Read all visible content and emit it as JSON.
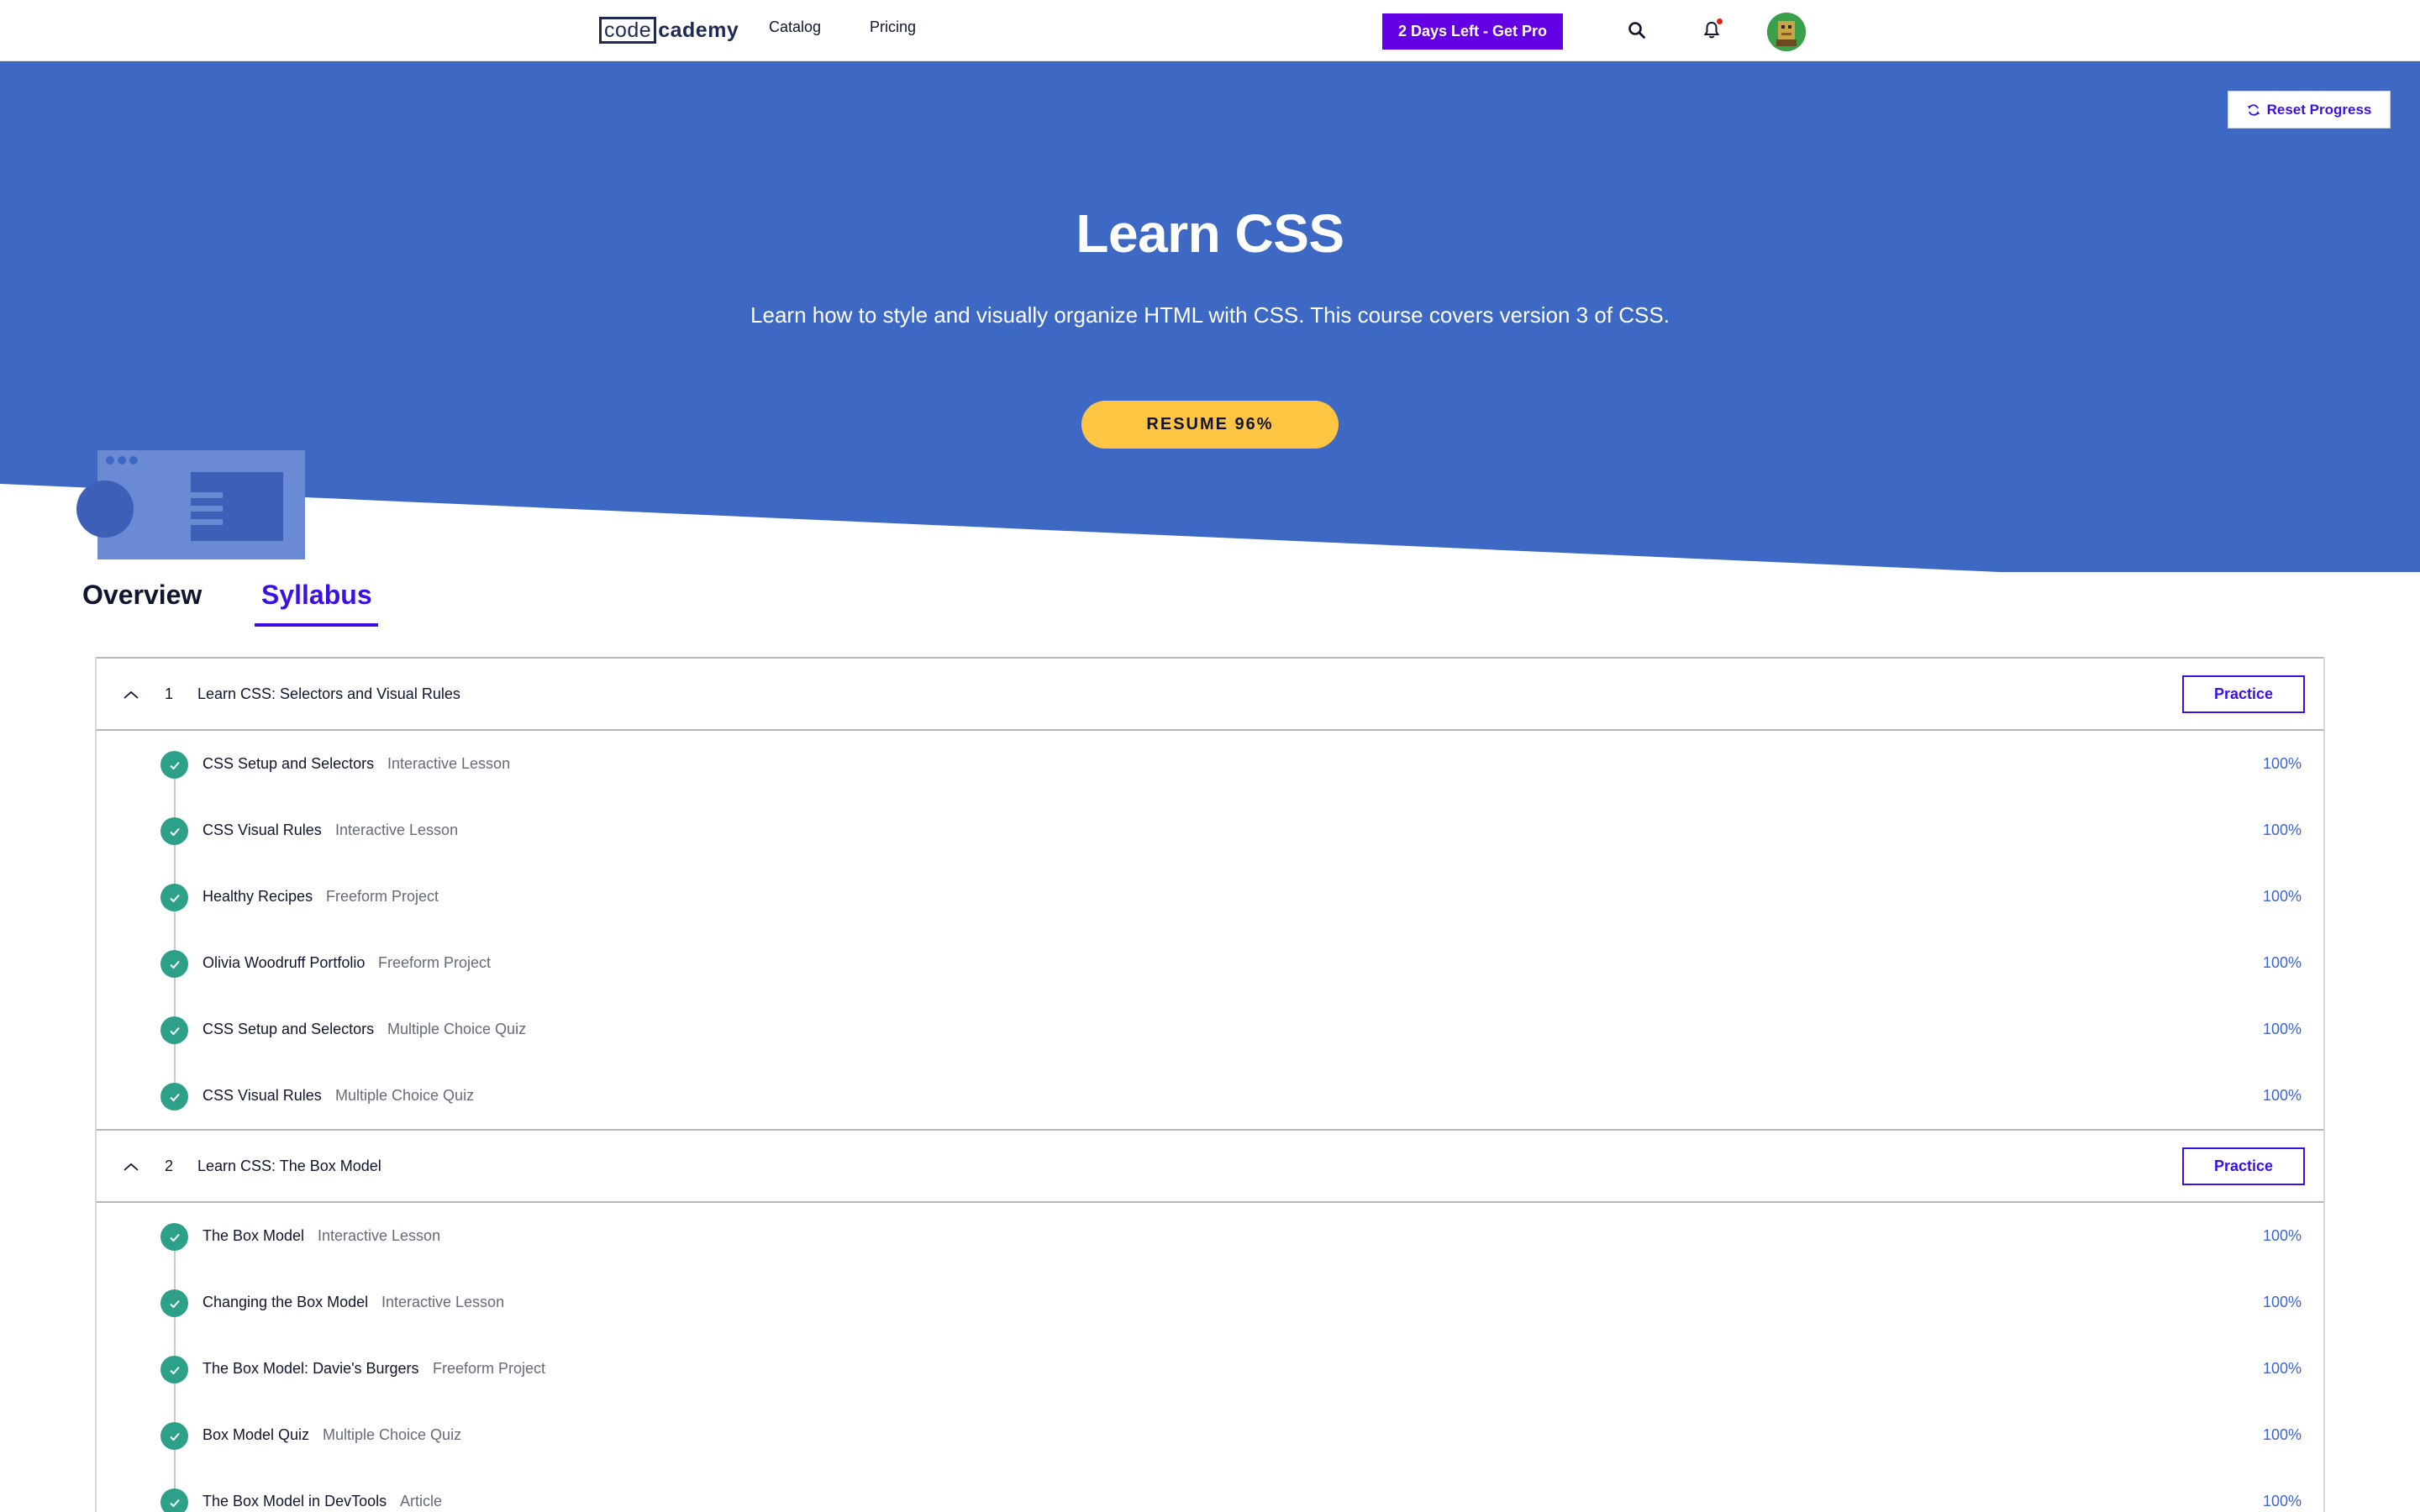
{
  "nav": {
    "logo_code": "code",
    "logo_rest": "cademy",
    "links": [
      "Catalog",
      "Pricing"
    ],
    "pro_button": "2 Days Left - Get Pro"
  },
  "hero": {
    "reset_label": "Reset Progress",
    "title": "Learn CSS",
    "subtitle": "Learn how to style and visually organize HTML with CSS. This course covers version 3 of CSS.",
    "resume_label": "RESUME 96%",
    "progress_percent": 96
  },
  "tabs": [
    {
      "label": "Overview",
      "active": false
    },
    {
      "label": "Syllabus",
      "active": true
    }
  ],
  "colors": {
    "hero_blue": "#3d68c3",
    "accent": "#3a10e5",
    "pro_purple": "#6400e4",
    "resume_yellow": "#ffc543",
    "check_green": "#2da08a",
    "percent_blue": "#3a64d8"
  },
  "icons": [
    "search-icon",
    "bell-icon",
    "refresh-icon",
    "chevron-up-icon",
    "checkmark-icon"
  ],
  "modules": [
    {
      "number": "1",
      "title": "Learn CSS: Selectors and Visual Rules",
      "practice_label": "Practice",
      "items": [
        {
          "title": "CSS Setup and Selectors",
          "type": "Interactive Lesson",
          "percent": "100%"
        },
        {
          "title": "CSS Visual Rules",
          "type": "Interactive Lesson",
          "percent": "100%"
        },
        {
          "title": "Healthy Recipes",
          "type": "Freeform Project",
          "percent": "100%"
        },
        {
          "title": "Olivia Woodruff Portfolio",
          "type": "Freeform Project",
          "percent": "100%"
        },
        {
          "title": "CSS Setup and Selectors",
          "type": "Multiple Choice Quiz",
          "percent": "100%"
        },
        {
          "title": "CSS Visual Rules",
          "type": "Multiple Choice Quiz",
          "percent": "100%"
        }
      ]
    },
    {
      "number": "2",
      "title": "Learn CSS: The Box Model",
      "practice_label": "Practice",
      "items": [
        {
          "title": "The Box Model",
          "type": "Interactive Lesson",
          "percent": "100%"
        },
        {
          "title": "Changing the Box Model",
          "type": "Interactive Lesson",
          "percent": "100%"
        },
        {
          "title": "The Box Model: Davie's Burgers",
          "type": "Freeform Project",
          "percent": "100%"
        },
        {
          "title": "Box Model Quiz",
          "type": "Multiple Choice Quiz",
          "percent": "100%"
        },
        {
          "title": "The Box Model in DevTools",
          "type": "Article",
          "percent": "100%"
        }
      ]
    }
  ]
}
